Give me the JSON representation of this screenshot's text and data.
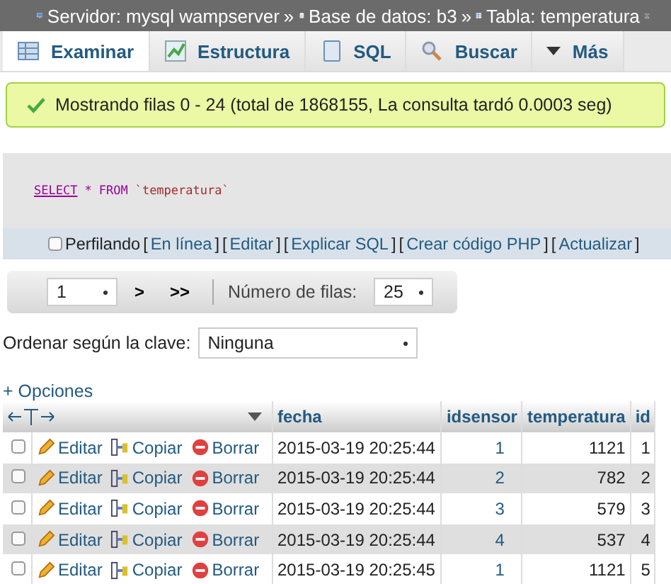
{
  "breadcrumb": [
    {
      "kind": "server",
      "label": "Servidor: mysql wampserver"
    },
    {
      "kind": "database",
      "label": "Base de datos: b3"
    },
    {
      "kind": "table",
      "label": "Tabla: temperatura"
    }
  ],
  "breadcrumb_separator": "»",
  "tabs": [
    {
      "kind": "browse",
      "label": "Examinar",
      "selected": true
    },
    {
      "kind": "structure",
      "label": "Estructura",
      "selected": false
    },
    {
      "kind": "sql",
      "label": "SQL",
      "selected": false
    },
    {
      "kind": "search",
      "label": "Buscar",
      "selected": false
    },
    {
      "kind": "more",
      "label": "Más",
      "selected": false
    }
  ],
  "message": "Mostrando filas 0 - 24 (total de 1868155, La consulta tardó 0.0003 seg)",
  "query": {
    "keyword1": "SELECT",
    "star": "*",
    "keyword2": "FROM",
    "table": "`temperatura`"
  },
  "profiling": {
    "label": "Perfilando",
    "checked": false,
    "links": [
      {
        "open": "[",
        "label": "En línea",
        "close": "]"
      },
      {
        "open": "[",
        "label": "Editar",
        "close": "]"
      },
      {
        "open": "[",
        "label": "Explicar SQL",
        "close": "]"
      },
      {
        "open": "[",
        "label": "Crear código PHP",
        "close": "]"
      },
      {
        "open": "[",
        "label": "Actualizar",
        "close": "]"
      }
    ]
  },
  "pager": {
    "page": "1",
    "next": ">",
    "last": ">>",
    "rows_label": "Número de filas:",
    "rows": "25"
  },
  "sort": {
    "label": "Ordenar según la clave:",
    "value": "Ninguna"
  },
  "options_link": "+ Opciones",
  "table": {
    "columns": [
      "fecha",
      "idsensor",
      "temperatura",
      "id"
    ],
    "rows": [
      {
        "checked": false,
        "actions": [
          "Editar",
          "Copiar",
          "Borrar"
        ],
        "cells": [
          "2015-03-19 20:25:44",
          "1",
          "1121",
          "1"
        ]
      },
      {
        "checked": false,
        "actions": [
          "Editar",
          "Copiar",
          "Borrar"
        ],
        "cells": [
          "2015-03-19 20:25:44",
          "2",
          "782",
          "2"
        ]
      },
      {
        "checked": false,
        "actions": [
          "Editar",
          "Copiar",
          "Borrar"
        ],
        "cells": [
          "2015-03-19 20:25:44",
          "3",
          "579",
          "3"
        ]
      },
      {
        "checked": false,
        "actions": [
          "Editar",
          "Copiar",
          "Borrar"
        ],
        "cells": [
          "2015-03-19 20:25:44",
          "4",
          "537",
          "4"
        ]
      },
      {
        "checked": false,
        "actions": [
          "Editar",
          "Copiar",
          "Borrar"
        ],
        "cells": [
          "2015-03-19 20:25:45",
          "1",
          "1121",
          "5"
        ]
      }
    ]
  }
}
